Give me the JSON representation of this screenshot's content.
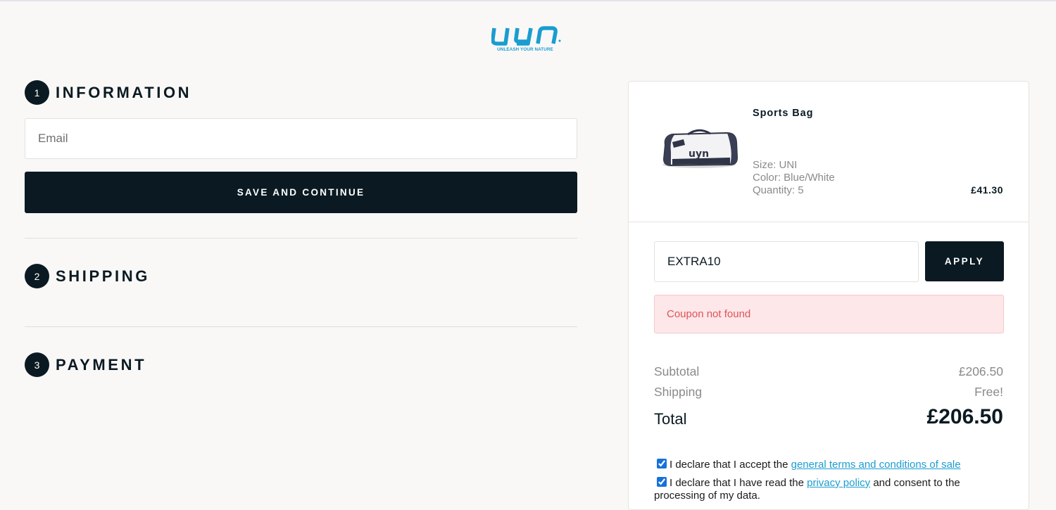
{
  "brand": {
    "logo_text": "UYN",
    "tagline": "UNLEASH YOUR NATURE",
    "accent_color": "#1a9dd0"
  },
  "steps": [
    {
      "number": "1",
      "title": "INFORMATION"
    },
    {
      "number": "2",
      "title": "SHIPPING"
    },
    {
      "number": "3",
      "title": "PAYMENT"
    }
  ],
  "information": {
    "email_placeholder": "Email",
    "email_value": "",
    "save_label": "SAVE AND CONTINUE"
  },
  "cart": {
    "items": [
      {
        "name": "Sports Bag",
        "image_icon": "sports-bag-image",
        "size": "Size: UNI",
        "color": "Color: Blue/White",
        "quantity": "Quantity: 5",
        "price": "£41.30"
      }
    ]
  },
  "coupon": {
    "value": "EXTRA10",
    "apply_label": "APPLY",
    "error": "Coupon not found"
  },
  "summary": {
    "subtotal_label": "Subtotal",
    "subtotal_value": "£206.50",
    "shipping_label": "Shipping",
    "shipping_value": "Free!",
    "total_label": "Total",
    "total_value": "£206.50"
  },
  "declarations": {
    "terms_prefix": "I declare that I accept the ",
    "terms_link": "general terms and conditions of sale",
    "terms_checked": true,
    "privacy_prefix": "I declare that I have read the ",
    "privacy_link": "privacy policy",
    "privacy_suffix": " and consent to the processing of my data.",
    "privacy_checked": true
  },
  "colors": {
    "dark": "#0b1a22",
    "background": "#f9f8f7",
    "error_bg": "#fde7e8",
    "error_text": "#e0525b",
    "link": "#1a9dd0"
  }
}
